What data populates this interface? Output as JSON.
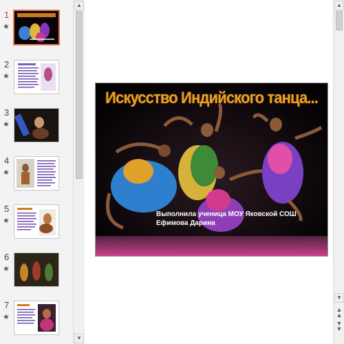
{
  "thumbnails": [
    {
      "number": "1",
      "star": "★",
      "active": true
    },
    {
      "number": "2",
      "star": "★",
      "active": false
    },
    {
      "number": "3",
      "star": "★",
      "active": false
    },
    {
      "number": "4",
      "star": "★",
      "active": false
    },
    {
      "number": "5",
      "star": "★",
      "active": false
    },
    {
      "number": "6",
      "star": "★",
      "active": false
    },
    {
      "number": "7",
      "star": "★",
      "active": false
    }
  ],
  "slide": {
    "title": "Искусство Индийского танца...",
    "caption_line1": "Выполнила ученица МОУ Яковской СОШ",
    "caption_line2": "Ефимова Дарина"
  },
  "icons": {
    "scroll_up": "scroll-up-icon",
    "scroll_down": "scroll-down-icon",
    "prev_slide": "previous-slide-icon",
    "next_slide": "next-slide-icon"
  },
  "colors": {
    "active_accent": "#e0764f",
    "title_color": "#e9a324"
  }
}
